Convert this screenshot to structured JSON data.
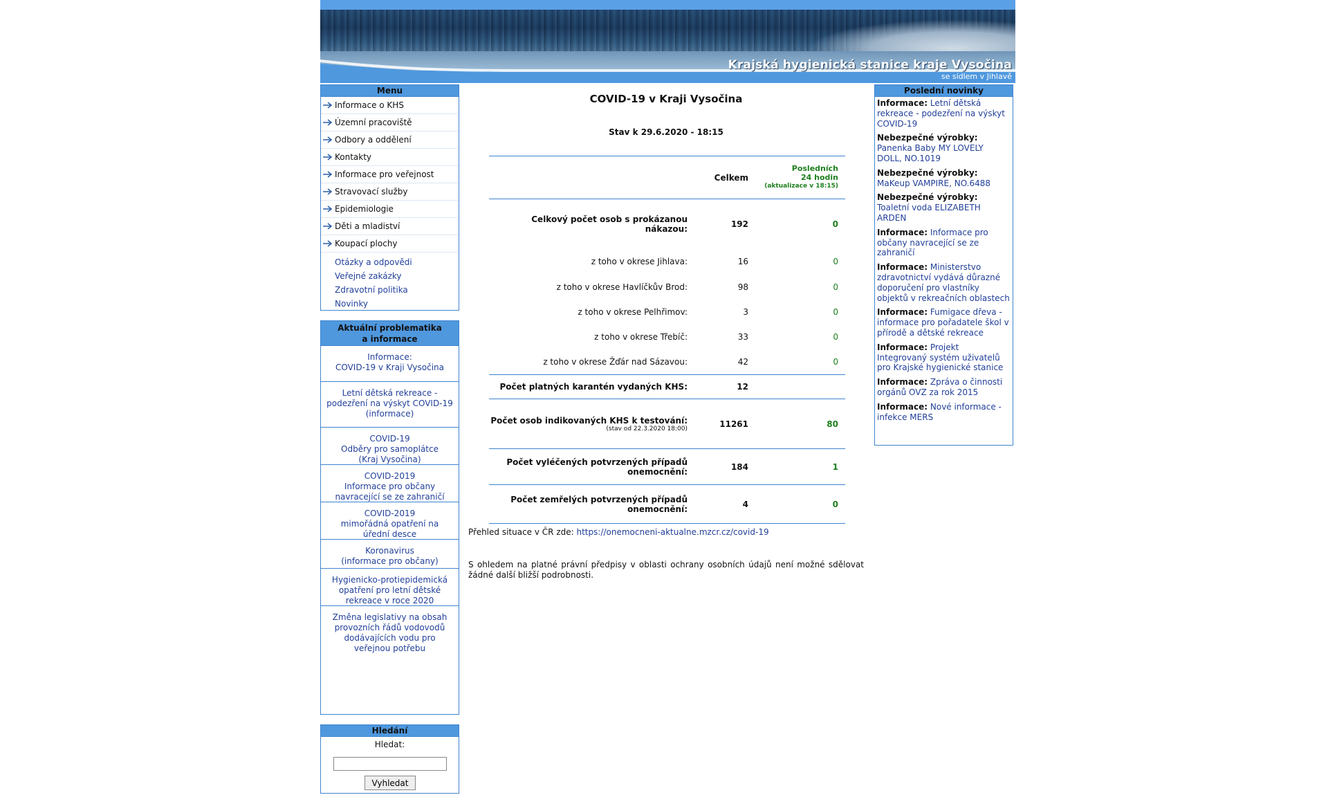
{
  "banner": {
    "title": "Krajská hygienická stanice kraje Vysočina",
    "subtitle": "se sídlem v Jihlavě"
  },
  "menu": {
    "heading": "Menu",
    "arrow_items": [
      "Informace o KHS",
      "Územní pracoviště",
      "Odbory a oddělení",
      "Kontakty",
      "Informace pro veřejnost",
      "Stravovací služby",
      "Epidemiologie",
      "Děti a mladiství",
      "Koupací plochy"
    ],
    "plain_items": [
      "Otázky a odpovědi",
      "Veřejné zakázky",
      "Zdravotní politika",
      "Novinky"
    ]
  },
  "aktualni": {
    "heading_line1": "Aktuální problematika",
    "heading_line2": "a informace",
    "items": [
      "Informace:\nCOVID-19 v Kraji Vysočina",
      "Letní dětská rekreace - podezření na výskyt COVID-19\n(informace)",
      "COVID-19\nOdběry pro samoplátce\n(Kraj Vysočina)",
      "COVID-2019\nInformace pro občany navracející se ze zahraničí",
      "COVID-2019\nmimořádná opatření na úřední desce",
      "Koronavirus\n(informace pro občany)",
      "Hygienicko-protiepidemická opatření pro letní dětské rekreace v roce 2020",
      "Změna legislativy na obsah provozních řádů vodovodů dodávajících vodu pro veřejnou potřebu"
    ]
  },
  "hledani": {
    "heading": "Hledání",
    "label": "Hledat:",
    "input_value": "",
    "button": "Vyhledat"
  },
  "center": {
    "title": "COVID-19 v Kraji Vysočina",
    "stav": "Stav k 29.6.2020 - 18:15",
    "col_total": "Celkem",
    "col_last_line1": "Posledních",
    "col_last_line2": "24 hodin",
    "col_last_note": "(aktualizace v 18:15)",
    "rows": [
      {
        "label": "Celkový počet osob s prokázanou nákazou:",
        "total": "192",
        "last": "0",
        "bold": true
      },
      {
        "label": "z toho v okrese Jihlava:",
        "total": "16",
        "last": "0",
        "bold": false
      },
      {
        "label": "z toho v okrese Havlíčkův Brod:",
        "total": "98",
        "last": "0",
        "bold": false
      },
      {
        "label": "z toho v okrese Pelhřimov:",
        "total": "3",
        "last": "0",
        "bold": false
      },
      {
        "label": "z toho v okrese Třebíč:",
        "total": "33",
        "last": "0",
        "bold": false
      },
      {
        "label": "z toho v okrese Žďár nad Sázavou:",
        "total": "42",
        "last": "0",
        "bold": false
      },
      {
        "label": "Počet platných karantén vydaných KHS:",
        "total": "12",
        "last": "",
        "bold": true
      },
      {
        "label": "Počet osob indikovaných KHS k testování:",
        "note": "(stav od 22.3.2020 18:00)",
        "total": "11261",
        "last": "80",
        "bold": true
      },
      {
        "label": "Počet vyléčených potvrzených případů onemocnění:",
        "total": "184",
        "last": "1",
        "bold": true
      },
      {
        "label": "Počet zemřelých potvrzených případů onemocnění:",
        "total": "4",
        "last": "0",
        "bold": true
      }
    ],
    "prehled_text": "Přehled situace v ČR zde: ",
    "prehled_link": "https://onemocneni-aktualne.mzcr.cz/covid-19",
    "ohledem": "S ohledem na platné právní předpisy v oblasti ochrany osobních údajů není možné sdělovat žádné další bližší podrobnosti."
  },
  "novinky": {
    "heading": "Poslední novinky",
    "items": [
      {
        "type": "Informace:",
        "text": "Letní dětská rekreace - podezření na výskyt COVID-19"
      },
      {
        "type": "Nebezpečné výrobky:",
        "text": "Panenka Baby MY LOVELY DOLL, NO.1019"
      },
      {
        "type": "Nebezpečné výrobky:",
        "text": "MaKeup VAMPIRE, NO.6488"
      },
      {
        "type": "Nebezpečné výrobky:",
        "text": "Toaletní voda ELIZABETH ARDEN"
      },
      {
        "type": "Informace:",
        "text": "Informace pro občany navracející se ze zahraničí"
      },
      {
        "type": "Informace:",
        "text": "Ministerstvo zdravotnictví vydává důrazné doporučení pro vlastníky objektů v rekreačních oblastech"
      },
      {
        "type": "Informace:",
        "text": "Fumigace dřeva - informace pro pořadatele škol v přírodě a dětské rekreace"
      },
      {
        "type": "Informace:",
        "text": "Projekt Integrovaný systém uživatelů pro Krajské hygienické stanice"
      },
      {
        "type": "Informace:",
        "text": "Zpráva o činnosti orgánů OVZ za rok 2015"
      },
      {
        "type": "Informace:",
        "text": "Nové informace - infekce MERS"
      }
    ]
  },
  "colors": {
    "accent_blue": "#4f98de",
    "border_blue": "#3f84cf",
    "link": "#22409a",
    "green": "#1d7f1d"
  }
}
